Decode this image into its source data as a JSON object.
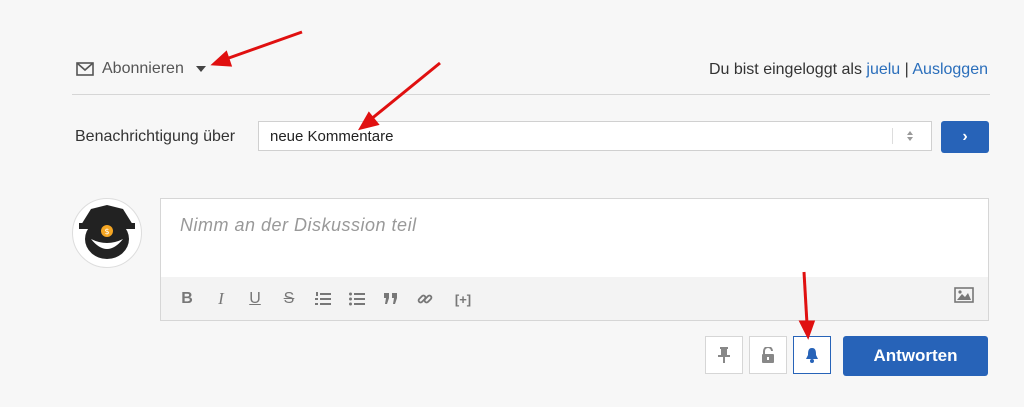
{
  "subscribe": {
    "label": "Abonnieren",
    "icon": "envelope-icon"
  },
  "login": {
    "prefix": "Du bist eingeloggt als ",
    "username": "juelu",
    "separator": " | ",
    "logout": "Ausloggen"
  },
  "notification": {
    "label": "Benachrichtigung über",
    "selected": "neue Kommentare",
    "submit": "›"
  },
  "editor": {
    "placeholder": "Nimm an der Diskussion teil",
    "toolbar": [
      "B",
      "I",
      "U",
      "S",
      "numbered-list-icon",
      "bullet-list-icon",
      "quote-icon",
      "link-icon",
      "[+]",
      "image-icon"
    ]
  },
  "actions": {
    "pin": "pin-icon",
    "lock": "lock-icon",
    "bell": "bell-icon",
    "answer": "Antworten"
  },
  "colors": {
    "primary": "#2763b8",
    "link": "#2a6ebb",
    "arrow": "#e01010"
  }
}
